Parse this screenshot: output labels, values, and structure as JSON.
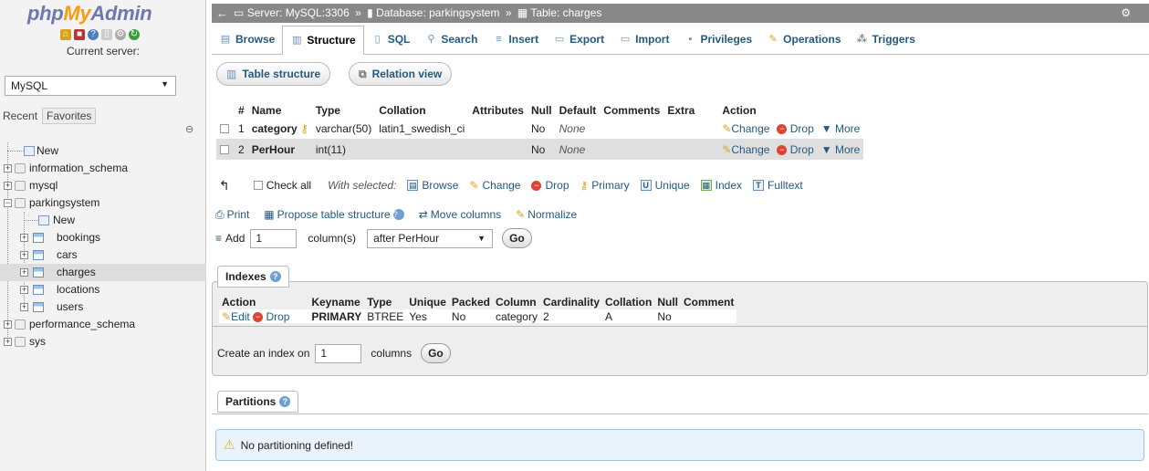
{
  "logo": {
    "php": "php",
    "my": "My",
    "admin": "Admin"
  },
  "sidebar": {
    "current_server_label": "Current server:",
    "server_value": "MySQL",
    "recent_tab": "Recent",
    "favorites_tab": "Favorites",
    "tree": {
      "new": "New",
      "information_schema": "information_schema",
      "mysql": "mysql",
      "parkingsystem": "parkingsystem",
      "ps_new": "New",
      "bookings": "bookings",
      "cars": "cars",
      "charges": "charges",
      "locations": "locations",
      "users": "users",
      "performance_schema": "performance_schema",
      "sys": "sys"
    }
  },
  "breadcrumb": {
    "server": "Server: MySQL:3306",
    "database": "Database: parkingsystem",
    "table": "Table: charges",
    "sep": "»"
  },
  "tabs": {
    "browse": "Browse",
    "structure": "Structure",
    "sql": "SQL",
    "search": "Search",
    "insert": "Insert",
    "export": "Export",
    "import": "Import",
    "privileges": "Privileges",
    "operations": "Operations",
    "triggers": "Triggers"
  },
  "subtabs": {
    "table_structure": "Table structure",
    "relation_view": "Relation view"
  },
  "structure_table": {
    "headers": {
      "num": "#",
      "name": "Name",
      "type": "Type",
      "collation": "Collation",
      "attributes": "Attributes",
      "null": "Null",
      "default": "Default",
      "comments": "Comments",
      "extra": "Extra",
      "action": "Action"
    },
    "rows": [
      {
        "num": "1",
        "name": "category",
        "type": "varchar(50)",
        "collation": "latin1_swedish_ci",
        "null": "No",
        "default": "None"
      },
      {
        "num": "2",
        "name": "PerHour",
        "type": "int(11)",
        "collation": "",
        "null": "No",
        "default": "None"
      }
    ],
    "action_change": "Change",
    "action_drop": "Drop",
    "action_more": "More"
  },
  "bulk": {
    "check_all": "Check all",
    "with_selected": "With selected:",
    "browse": "Browse",
    "change": "Change",
    "drop": "Drop",
    "primary": "Primary",
    "unique": "Unique",
    "index": "Index",
    "fulltext": "Fulltext"
  },
  "tools": {
    "print": "Print",
    "propose": "Propose table structure",
    "move_columns": "Move columns",
    "normalize": "Normalize"
  },
  "add_column": {
    "label": "Add",
    "count": "1",
    "columns_label": "column(s)",
    "position": "after PerHour",
    "go": "Go"
  },
  "indexes": {
    "legend": "Indexes",
    "headers": {
      "action": "Action",
      "keyname": "Keyname",
      "type": "Type",
      "unique": "Unique",
      "packed": "Packed",
      "column": "Column",
      "cardinality": "Cardinality",
      "collation": "Collation",
      "null": "Null",
      "comment": "Comment"
    },
    "row": {
      "edit": "Edit",
      "drop": "Drop",
      "keyname": "PRIMARY",
      "type": "BTREE",
      "unique": "Yes",
      "packed": "No",
      "column": "category",
      "cardinality": "2",
      "collation": "A",
      "null": "No",
      "comment": ""
    },
    "create_label": "Create an index on",
    "create_count": "1",
    "columns_label": "columns",
    "go": "Go"
  },
  "partitions": {
    "legend": "Partitions",
    "message": "No partitioning defined!"
  }
}
